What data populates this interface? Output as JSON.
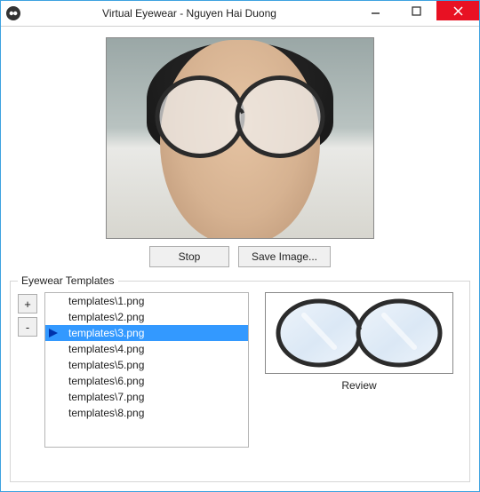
{
  "window": {
    "title": "Virtual Eyewear - Nguyen Hai Duong"
  },
  "buttons": {
    "stop": "Stop",
    "save_image": "Save Image...",
    "add": "+",
    "remove": "-"
  },
  "group": {
    "legend": "Eyewear Templates",
    "review_label": "Review"
  },
  "templates": {
    "items": [
      {
        "path": "templates\\1.png",
        "selected": false
      },
      {
        "path": "templates\\2.png",
        "selected": false
      },
      {
        "path": "templates\\3.png",
        "selected": true
      },
      {
        "path": "templates\\4.png",
        "selected": false
      },
      {
        "path": "templates\\5.png",
        "selected": false
      },
      {
        "path": "templates\\6.png",
        "selected": false
      },
      {
        "path": "templates\\7.png",
        "selected": false
      },
      {
        "path": "templates\\8.png",
        "selected": false
      }
    ]
  }
}
